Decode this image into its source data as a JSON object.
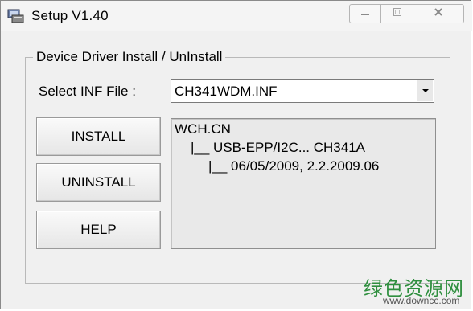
{
  "window": {
    "title": "Setup V1.40",
    "icon": "installer-icon",
    "controls": {
      "minimize_icon": "minimize-icon",
      "maximize_icon": "maximize-icon",
      "close_icon": "close-icon"
    }
  },
  "group": {
    "label": "Device Driver Install / UnInstall"
  },
  "inf": {
    "label": "Select INF File :",
    "selected": "CH341WDM.INF"
  },
  "buttons": {
    "install": "INSTALL",
    "uninstall": "UNINSTALL",
    "help": "HELP"
  },
  "info": {
    "line1": "WCH.CN",
    "line2": "|__ USB-EPP/I2C... CH341A",
    "line3": "|__ 06/05/2009, 2.2.2009.06"
  },
  "watermark": {
    "text_cn": "绿色资源网",
    "url": "www.downcc.com"
  },
  "colors": {
    "window_bg": "#f0f0f0",
    "watermark_green": "#2f8f3f"
  }
}
